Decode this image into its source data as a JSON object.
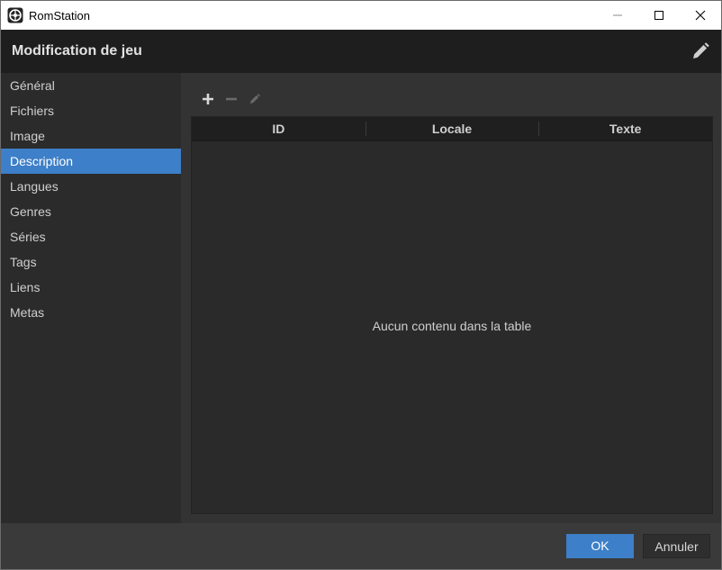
{
  "window": {
    "title": "RomStation"
  },
  "header": {
    "title": "Modification de jeu"
  },
  "sidebar": {
    "items": [
      {
        "label": "Général"
      },
      {
        "label": "Fichiers"
      },
      {
        "label": "Image"
      },
      {
        "label": "Description"
      },
      {
        "label": "Langues"
      },
      {
        "label": "Genres"
      },
      {
        "label": "Séries"
      },
      {
        "label": "Tags"
      },
      {
        "label": "Liens"
      },
      {
        "label": "Metas"
      }
    ],
    "active": "Description"
  },
  "table": {
    "columns": [
      "ID",
      "Locale",
      "Texte"
    ],
    "empty_message": "Aucun contenu dans la table"
  },
  "footer": {
    "ok_label": "OK",
    "cancel_label": "Annuler"
  },
  "colors": {
    "accent": "#3d7fc8",
    "header_bg": "#1e1e1e",
    "sidebar_bg": "#2b2b2b"
  },
  "icons": [
    "app-icon",
    "minimize-icon",
    "maximize-icon",
    "close-icon",
    "pencil-icon",
    "plus-icon",
    "minus-icon"
  ]
}
